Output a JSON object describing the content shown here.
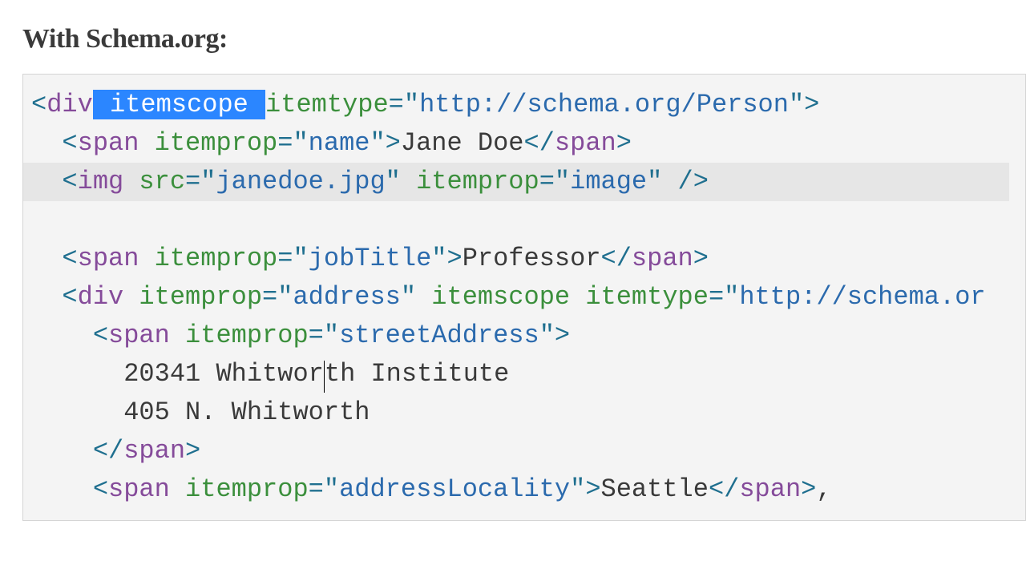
{
  "heading": "With Schema.org:",
  "code": {
    "line1": {
      "tag_open": "<",
      "tag": "div",
      "attr1_sel": " itemscope ",
      "attr2": "itemtype",
      "eq_q": "=\"",
      "val2": "http://schema.org/Person",
      "q_close": "\"",
      "tag_close": ">"
    },
    "line2": {
      "indent": "  ",
      "o": "<",
      "tag": "span",
      "sp": " ",
      "attr": "itemprop",
      "eq": "=\"",
      "val": "name",
      "q": "\"",
      "c": ">",
      "text": "Jane Doe",
      "co": "</",
      "ctag": "span",
      "cc": ">"
    },
    "line3": {
      "indent": "  ",
      "o": "<",
      "tag": "img",
      "sp": " ",
      "attr1": "src",
      "eq1": "=\"",
      "val1": "janedoe.jpg",
      "q1": "\"",
      "sp2": " ",
      "attr2": "itemprop",
      "eq2": "=\"",
      "val2": "image",
      "q2": "\"",
      "close": " />"
    },
    "line5": {
      "indent": "  ",
      "o": "<",
      "tag": "span",
      "sp": " ",
      "attr": "itemprop",
      "eq": "=\"",
      "val": "jobTitle",
      "q": "\"",
      "c": ">",
      "text": "Professor",
      "co": "</",
      "ctag": "span",
      "cc": ">"
    },
    "line6": {
      "indent": "  ",
      "o": "<",
      "tag": "div",
      "sp": " ",
      "attr1": "itemprop",
      "eq1": "=\"",
      "val1": "address",
      "q1": "\"",
      "sp2": " ",
      "attr2": "itemscope",
      "sp3": " ",
      "attr3": "itemtype",
      "eq3": "=\"",
      "val3": "http://schema.or"
    },
    "line7": {
      "indent": "    ",
      "o": "<",
      "tag": "span",
      "sp": " ",
      "attr": "itemprop",
      "eq": "=\"",
      "val": "streetAddress",
      "q": "\"",
      "c": ">"
    },
    "line8": {
      "indent": "      ",
      "text_a": "20341 Whitwo",
      "text_b": "th Institute"
    },
    "line9": {
      "indent": "      ",
      "text": "405 N. Whitworth"
    },
    "line10": {
      "indent": "    ",
      "co": "</",
      "ctag": "span",
      "cc": ">"
    },
    "line11": {
      "indent": "    ",
      "o": "<",
      "tag": "span",
      "sp": " ",
      "attr": "itemprop",
      "eq": "=\"",
      "val": "addressLocality",
      "q": "\"",
      "c": ">",
      "text": "Seattle",
      "co": "</",
      "ctag": "span",
      "cc": ">",
      "tail": ","
    }
  }
}
